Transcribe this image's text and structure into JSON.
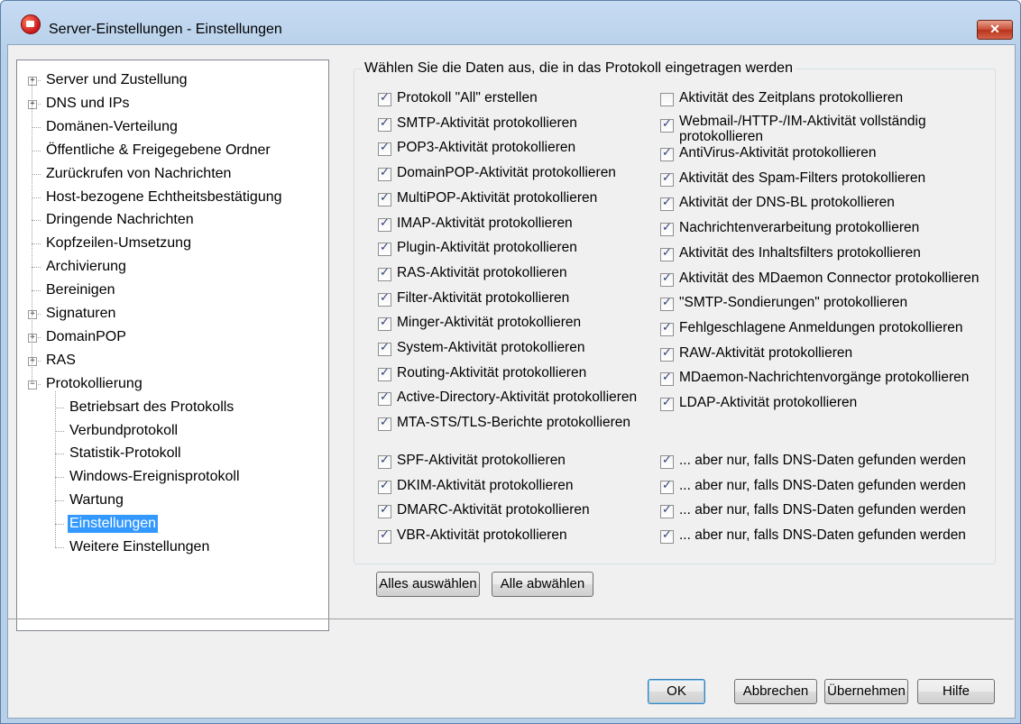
{
  "window": {
    "title": "Server-Einstellungen - Einstellungen",
    "close_label": "✕"
  },
  "tree": {
    "items": [
      {
        "label": "Server und Zustellung",
        "expandable": true,
        "level": 0
      },
      {
        "label": "DNS und IPs",
        "expandable": true,
        "level": 0
      },
      {
        "label": "Domänen-Verteilung",
        "expandable": false,
        "level": 0
      },
      {
        "label": "Öffentliche & Freigegebene Ordner",
        "expandable": false,
        "level": 0
      },
      {
        "label": "Zurückrufen von Nachrichten",
        "expandable": false,
        "level": 0
      },
      {
        "label": "Host-bezogene Echtheitsbestätigung",
        "expandable": false,
        "level": 0
      },
      {
        "label": "Dringende Nachrichten",
        "expandable": false,
        "level": 0
      },
      {
        "label": "Kopfzeilen-Umsetzung",
        "expandable": false,
        "level": 0
      },
      {
        "label": "Archivierung",
        "expandable": false,
        "level": 0
      },
      {
        "label": "Bereinigen",
        "expandable": false,
        "level": 0
      },
      {
        "label": "Signaturen",
        "expandable": true,
        "level": 0
      },
      {
        "label": "DomainPOP",
        "expandable": true,
        "level": 0
      },
      {
        "label": "RAS",
        "expandable": true,
        "level": 0
      },
      {
        "label": "Protokollierung",
        "expandable": true,
        "expanded": true,
        "level": 0
      },
      {
        "label": "Betriebsart des Protokolls",
        "level": 1
      },
      {
        "label": "Verbundprotokoll",
        "level": 1
      },
      {
        "label": "Statistik-Protokoll",
        "level": 1
      },
      {
        "label": "Windows-Ereignisprotokoll",
        "level": 1
      },
      {
        "label": "Wartung",
        "level": 1
      },
      {
        "label": "Einstellungen",
        "level": 1,
        "selected": true
      },
      {
        "label": "Weitere Einstellungen",
        "level": 1
      }
    ]
  },
  "group": {
    "label": "Wählen Sie die Daten aus, die in das Protokoll eingetragen werden",
    "left_column": [
      {
        "label": "Protokoll \"All\" erstellen",
        "checked": true
      },
      {
        "label": "SMTP-Aktivität protokollieren",
        "checked": true
      },
      {
        "label": "POP3-Aktivität protokollieren",
        "checked": true
      },
      {
        "label": "DomainPOP-Aktivität protokollieren",
        "checked": true
      },
      {
        "label": "MultiPOP-Aktivität protokollieren",
        "checked": true
      },
      {
        "label": "IMAP-Aktivität protokollieren",
        "checked": true
      },
      {
        "label": "Plugin-Aktivität protokollieren",
        "checked": true
      },
      {
        "label": "RAS-Aktivität protokollieren",
        "checked": true
      },
      {
        "label": "Filter-Aktivität protokollieren",
        "checked": true
      },
      {
        "label": "Minger-Aktivität protokollieren",
        "checked": true
      },
      {
        "label": "System-Aktivität protokollieren",
        "checked": true
      },
      {
        "label": "Routing-Aktivität protokollieren",
        "checked": true
      },
      {
        "label": "Active-Directory-Aktivität protokollieren",
        "checked": true
      },
      {
        "label": "MTA-STS/TLS-Berichte protokollieren",
        "checked": true
      }
    ],
    "right_column": [
      {
        "label": "Aktivität des Zeitplans protokollieren",
        "checked": false
      },
      {
        "label": "Webmail-/HTTP-/IM-Aktivität vollständig protokollieren",
        "checked": true,
        "two_lines": true
      },
      {
        "label": "AntiVirus-Aktivität protokollieren",
        "checked": true
      },
      {
        "label": "Aktivität des Spam-Filters protokollieren",
        "checked": true
      },
      {
        "label": "Aktivität der DNS-BL protokollieren",
        "checked": true
      },
      {
        "label": "Nachrichtenverarbeitung protokollieren",
        "checked": true
      },
      {
        "label": "Aktivität des Inhaltsfilters protokollieren",
        "checked": true
      },
      {
        "label": "Aktivität des MDaemon Connector protokollieren",
        "checked": true
      },
      {
        "label": "\"SMTP-Sondierungen\" protokollieren",
        "checked": true
      },
      {
        "label": "Fehlgeschlagene Anmeldungen protokollieren",
        "checked": true
      },
      {
        "label": "RAW-Aktivität protokollieren",
        "checked": true
      },
      {
        "label": "MDaemon-Nachrichtenvorgänge protokollieren",
        "checked": true
      },
      {
        "label": "LDAP-Aktivität protokollieren",
        "checked": true
      }
    ],
    "auth_left": [
      {
        "label": "SPF-Aktivität protokollieren",
        "checked": true
      },
      {
        "label": "DKIM-Aktivität protokollieren",
        "checked": true
      },
      {
        "label": "DMARC-Aktivität protokollieren",
        "checked": true
      },
      {
        "label": "VBR-Aktivität protokollieren",
        "checked": true
      }
    ],
    "auth_right": [
      {
        "label": "... aber nur, falls DNS-Daten gefunden werden",
        "checked": true
      },
      {
        "label": "... aber nur, falls DNS-Daten gefunden werden",
        "checked": true
      },
      {
        "label": "... aber nur, falls DNS-Daten gefunden werden",
        "checked": true
      },
      {
        "label": "... aber nur, falls DNS-Daten gefunden werden",
        "checked": true
      }
    ]
  },
  "actions": {
    "select_all": "Alles auswählen",
    "deselect_all": "Alle abwählen"
  },
  "footer": {
    "ok": "OK",
    "cancel": "Abbrechen",
    "apply": "Übernehmen",
    "help": "Hilfe"
  }
}
